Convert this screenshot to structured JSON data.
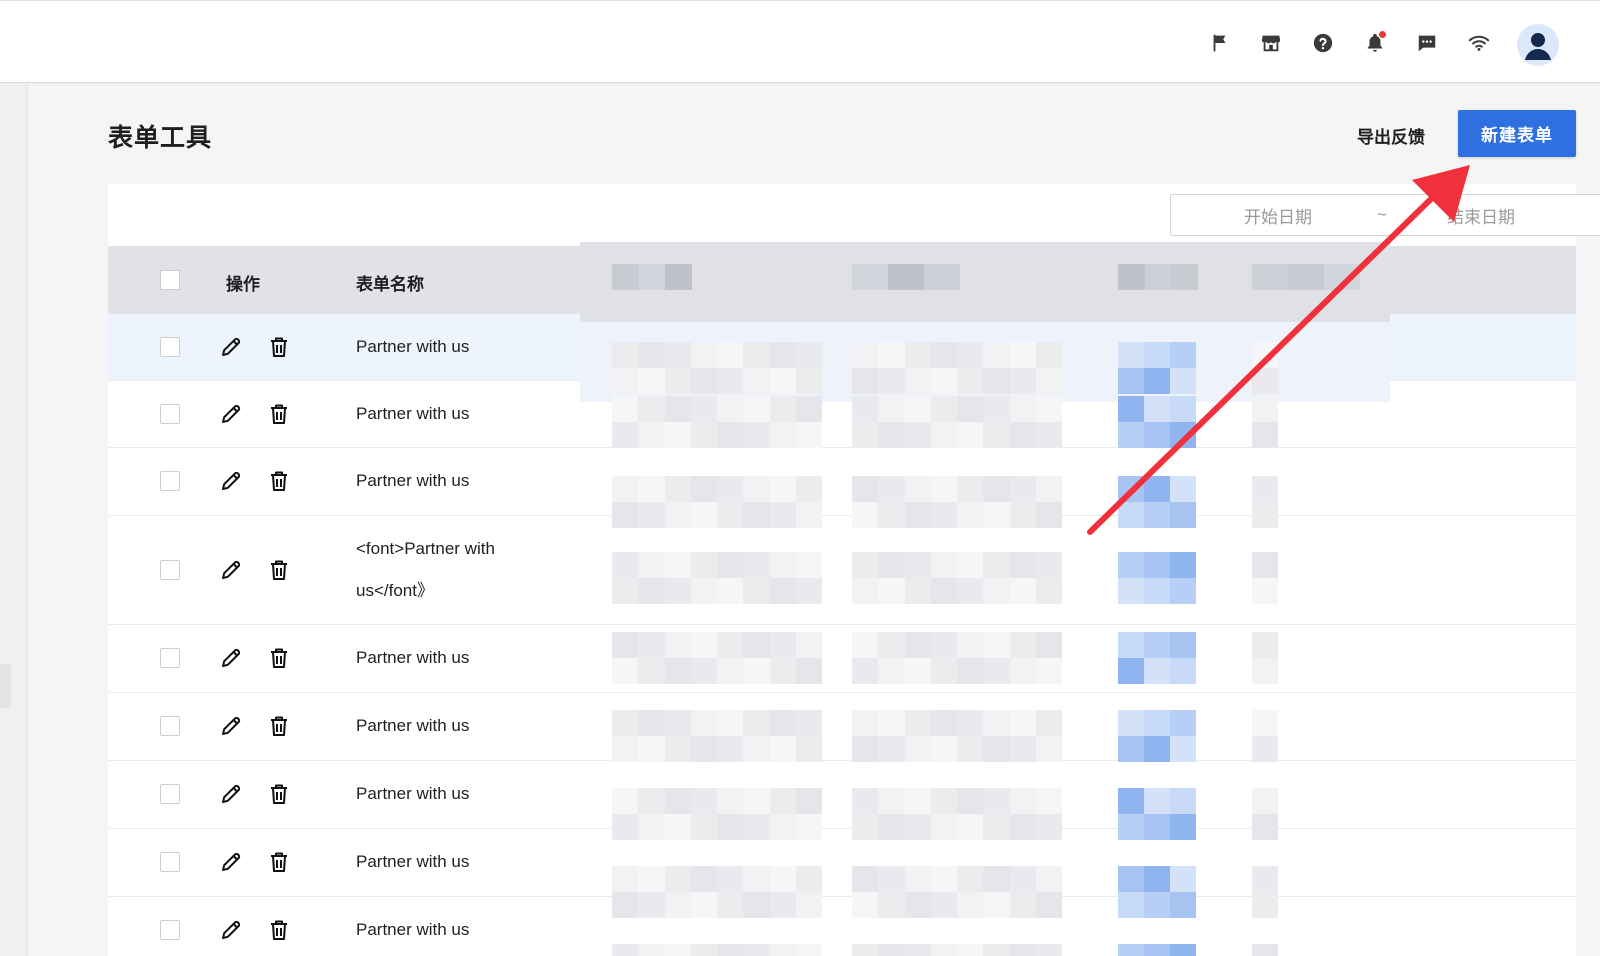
{
  "colors": {
    "primary": "#2f6fe0",
    "header_bg": "#e0e2e8",
    "row_highlight": "#eef4fd",
    "annotation_arrow": "#f0303a"
  },
  "topbar": {
    "icons": [
      "flag-icon",
      "store-icon",
      "help-icon",
      "bell-icon",
      "message-icon",
      "wifi-icon",
      "avatar"
    ]
  },
  "page": {
    "title": "表单工具",
    "export_label": "导出反馈",
    "new_button_label": "新建表单"
  },
  "filters": {
    "start_date_placeholder": "开始日期",
    "separator": "~",
    "end_date_placeholder": "结束日期"
  },
  "table": {
    "columns": {
      "operations": "操作",
      "form_name": "表单名称"
    },
    "rows": [
      {
        "name": "Partner with us",
        "highlighted": true
      },
      {
        "name": "Partner with us"
      },
      {
        "name": "Partner with us"
      },
      {
        "name": "<font>Partner with us</font》"
      },
      {
        "name": "Partner with us"
      },
      {
        "name": "Partner with us"
      },
      {
        "name": "Partner with us"
      },
      {
        "name": "Partner with us"
      },
      {
        "name": "Partner with us"
      }
    ]
  }
}
